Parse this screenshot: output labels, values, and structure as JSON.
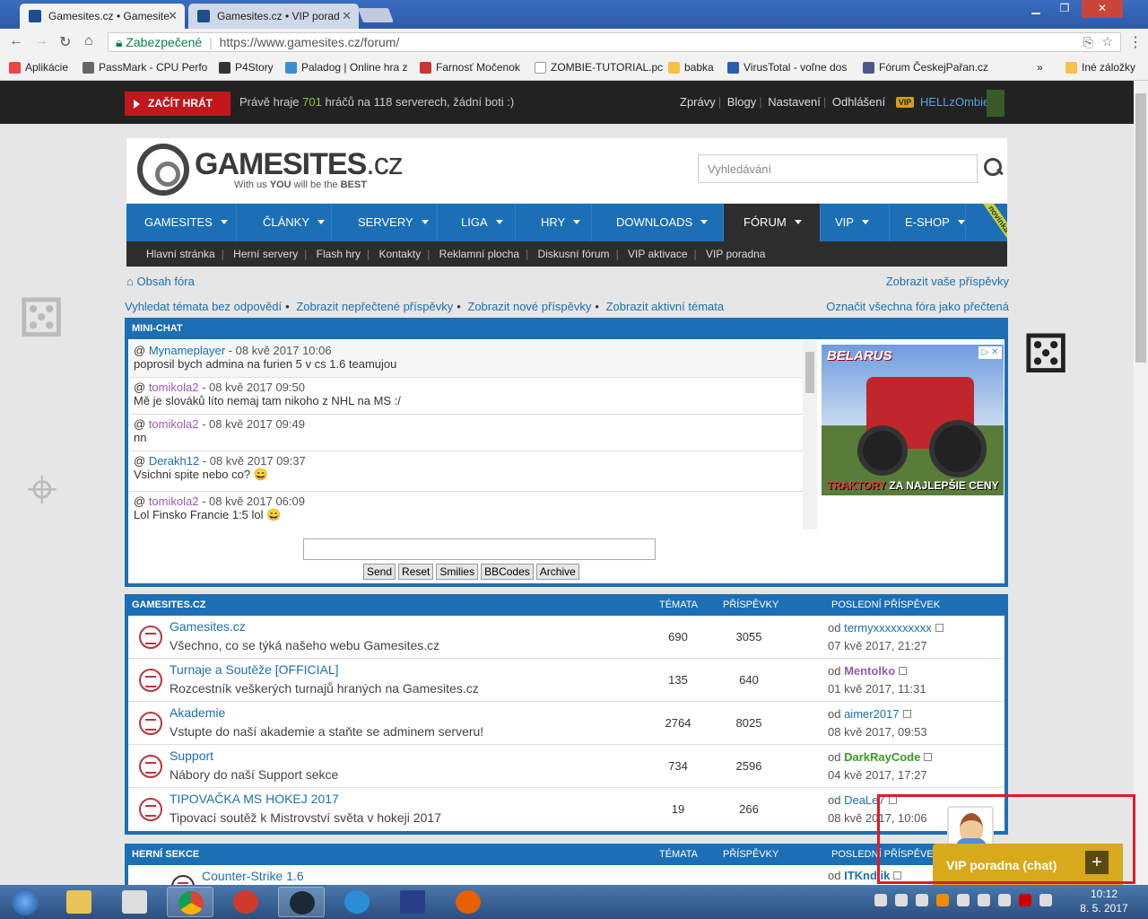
{
  "browser": {
    "tabs": [
      {
        "label": "Gamesites.cz • Gamesite"
      },
      {
        "label": "Gamesites.cz • VIP porad"
      }
    ],
    "secure_label": "Zabezpečené",
    "url": "https://www.gamesites.cz/forum/",
    "bookmarks": [
      "Aplikácie",
      "PassMark - CPU Perfo",
      "P4Story",
      "Paladog | Online hra z",
      "Farnosť Močenok",
      "ZOMBIE-TUTORIAL.pc",
      "babka",
      "VirusTotal - voľne dos",
      "Fórum ČeskejPařan.cz",
      "»",
      "Iné záložky"
    ]
  },
  "topbar": {
    "play_label": "ZAČÍT HRÁT",
    "status_prefix": "Právě hraje",
    "players": "701",
    "status_suffix": "hráčů na 118 serverech, žádní boti :)",
    "links": [
      "Zprávy",
      "Blogy",
      "Nastavení",
      "Odhlášení"
    ],
    "vip_badge": "VIP",
    "username": "HELLzOmbie"
  },
  "header": {
    "logo_main": "GAMESITES",
    "logo_tld": ".cz",
    "slogan_a": "With us ",
    "slogan_you": "YOU",
    "slogan_b": " will be the ",
    "slogan_best": "BEST",
    "search_placeholder": "Vyhledávání"
  },
  "mainnav": [
    "GAMESITES",
    "ČLÁNKY",
    "SERVERY",
    "LIGA",
    "HRY",
    "DOWNLOADS",
    "FÓRUM",
    "VIP",
    "E-SHOP"
  ],
  "novinka": "novinka",
  "subnav": [
    "Hlavní stránka",
    "Herní servery",
    "Flash hry",
    "Kontakty",
    "Reklamní plocha",
    "Diskusní fórum",
    "VIP aktivace",
    "VIP poradna"
  ],
  "crumbs": {
    "home": "Obsah fóra",
    "right": "Zobrazit vaše příspěvky"
  },
  "quicklinks": {
    "items": [
      "Vyhledat témata bez odpovědí",
      "Zobrazit nepřečtené příspěvky",
      "Zobrazit nové příspěvky",
      "Zobrazit aktivní témata"
    ],
    "right": "Označit všechna fóra jako přečtená"
  },
  "minichat": {
    "title": "MINI-CHAT",
    "messages": [
      {
        "user": "Mynameplayer",
        "time": " - 08 kvě 2017 10:06",
        "text": "poprosil bych admina na furien 5 v cs 1.6 teamujou"
      },
      {
        "user": "tomikola2",
        "time": " - 08 kvě 2017 09:50",
        "text": "Mě je slováků líto nemaj tam nikoho z NHL na MS :/"
      },
      {
        "user": "tomikola2",
        "time": " - 08 kvě 2017 09:49",
        "text": "nn"
      },
      {
        "user": "Derakh12",
        "time": " - 08 kvě 2017 09:37",
        "text": "Vsichni spite nebo co? 😄"
      },
      {
        "user": "tomikola2",
        "time": " - 08 kvě 2017 06:09",
        "text": "Lol Finsko Francie 1:5 lol 😄"
      }
    ],
    "buttons": [
      "Send",
      "Reset",
      "Smilies",
      "BBCodes",
      "Archive"
    ],
    "ad": {
      "brand": "BELARUS",
      "slogan_red": "TRAKTORY",
      "slogan_white": " ZA NAJLEPŠIE CENY",
      "badge": "▷ ✕"
    }
  },
  "columns": {
    "topics": "TÉMATA",
    "posts": "PŘÍSPĚVKY",
    "last": "POSLEDNÍ PŘÍSPĚVEK"
  },
  "gamesites_section": {
    "title": "GAMESITES.CZ",
    "forums": [
      {
        "title": "Gamesites.cz",
        "desc": "Všechno, co se týká našeho webu Gamesites.cz",
        "topics": "690",
        "posts": "3055",
        "by": "od ",
        "user": "termyxxxxxxxxxx",
        "date": "07 kvě 2017, 21:27"
      },
      {
        "title": "Turnaje a Soutěže [OFFICIAL]",
        "desc": "Rozcestník veškerých turnajů hraných na Gamesites.cz",
        "topics": "135",
        "posts": "640",
        "by": "od ",
        "user": "Mentolko",
        "date": "01 kvě 2017, 11:31"
      },
      {
        "title": "Akademie",
        "desc": "Vstupte do naší akademie a staňte se adminem serveru!",
        "topics": "2764",
        "posts": "8025",
        "by": "od ",
        "user": "aimer2017",
        "date": "08 kvě 2017, 09:53"
      },
      {
        "title": "Support",
        "desc": "Nábory do naší Support sekce",
        "topics": "734",
        "posts": "2596",
        "by": "od ",
        "user": "DarkRayCode",
        "date": "04 kvě 2017, 17:27"
      },
      {
        "title": "TIPOVAČKA MS HOKEJ 2017",
        "desc": "Tipovací soutěž k Mistrovství světa v hokeji 2017",
        "topics": "19",
        "posts": "266",
        "by": "od ",
        "user": "DeaLe7",
        "date": "08 kvě 2017, 10:06"
      }
    ]
  },
  "herni_section": {
    "title": "HERNÍ SEKCE",
    "forums": [
      {
        "title": "Counter-Strike 1.6",
        "by": "od ",
        "user": "ITKndlik"
      }
    ]
  },
  "vip_widget": {
    "label": "VIP poradna (chat)",
    "plus": "+"
  },
  "taskbar": {
    "time": "10:12",
    "date": "8. 5. 2017"
  },
  "colors": {
    "accent_blue": "#1c6fb5",
    "play_red": "#c2171d",
    "vip_gold": "#d7a91b",
    "highlight_red": "#e01b24"
  }
}
